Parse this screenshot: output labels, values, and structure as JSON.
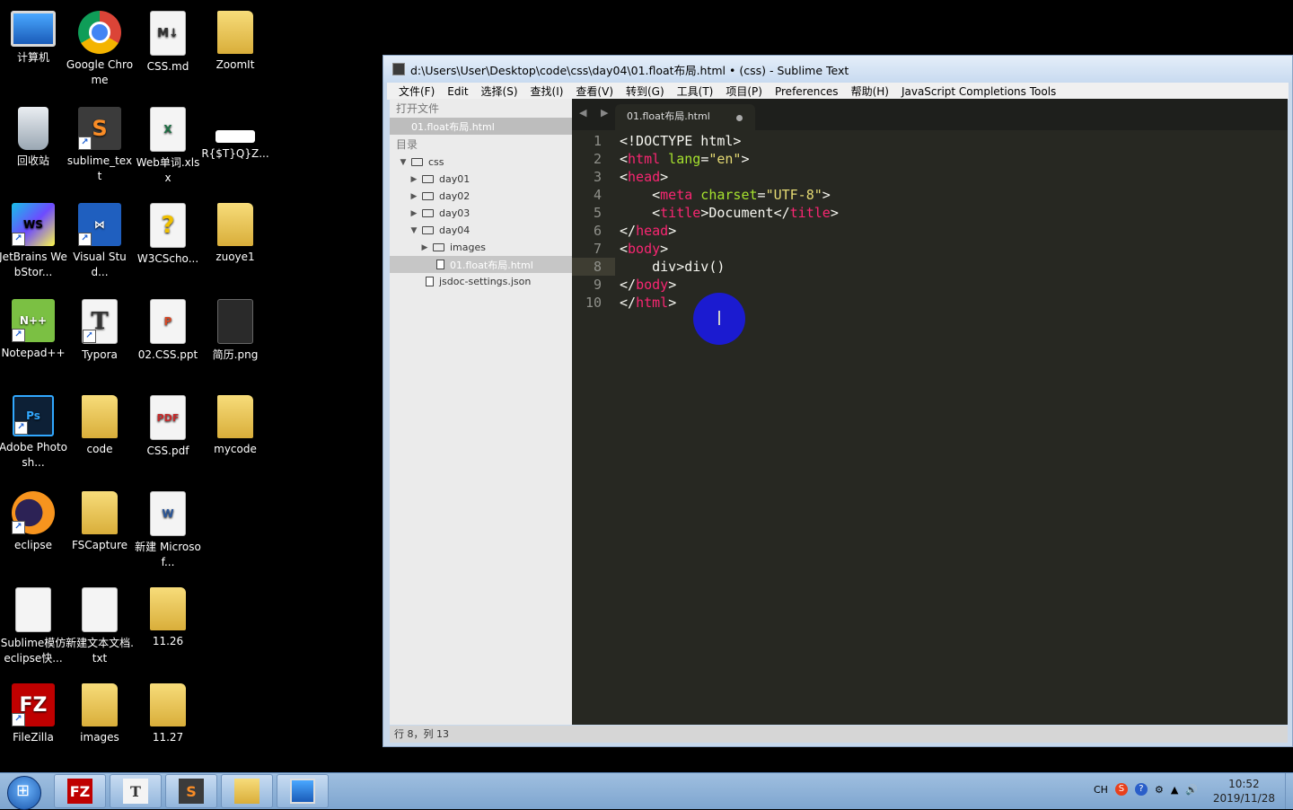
{
  "desktop": {
    "icons": [
      {
        "label": "计算机"
      },
      {
        "label": "Google Chrome"
      },
      {
        "label": "CSS.md"
      },
      {
        "label": "ZoomIt"
      },
      {
        "label": "回收站"
      },
      {
        "label": "sublime_text"
      },
      {
        "label": "Web单词.xlsx"
      },
      {
        "label": "R{$T}Q}Z..."
      },
      {
        "label": "JetBrains WebStor..."
      },
      {
        "label": "Visual Stud..."
      },
      {
        "label": "W3CScho..."
      },
      {
        "label": "zuoye1"
      },
      {
        "label": "Notepad++"
      },
      {
        "label": "Typora"
      },
      {
        "label": "02.CSS.ppt"
      },
      {
        "label": "简历.png"
      },
      {
        "label": "Adobe Photosh..."
      },
      {
        "label": "code"
      },
      {
        "label": "CSS.pdf"
      },
      {
        "label": "mycode"
      },
      {
        "label": "eclipse"
      },
      {
        "label": "FSCapture"
      },
      {
        "label": "新建 Microsof..."
      },
      {
        "label": "Sublime模仿eclipse快..."
      },
      {
        "label": "新建文本文档.txt"
      },
      {
        "label": "11.26"
      },
      {
        "label": "FileZilla"
      },
      {
        "label": "images"
      },
      {
        "label": "11.27"
      }
    ]
  },
  "window": {
    "title": "d:\\Users\\User\\Desktop\\code\\css\\day04\\01.float布局.html • (css) - Sublime Text",
    "menu": [
      "文件(F)",
      "Edit",
      "选择(S)",
      "查找(I)",
      "查看(V)",
      "转到(G)",
      "工具(T)",
      "项目(P)",
      "Preferences",
      "帮助(H)",
      "JavaScript Completions Tools"
    ]
  },
  "sidebar": {
    "open_files_header": "打开文件",
    "open_file": "01.float布局.html",
    "folders_header": "目录",
    "tree": {
      "css": "css",
      "day01": "day01",
      "day02": "day02",
      "day03": "day03",
      "day04": "day04",
      "images": "images",
      "file_active": "01.float布局.html",
      "jsdoc": "jsdoc-settings.json"
    }
  },
  "editor": {
    "tab_label": "01.float布局.html",
    "line_numbers": [
      "1",
      "2",
      "3",
      "4",
      "5",
      "6",
      "7",
      "8",
      "9",
      "10"
    ],
    "lines": {
      "l1": "<!DOCTYPE html>",
      "l2_open": "<",
      "l2_tag": "html",
      "l2_attr": " lang",
      "l2_eq": "=",
      "l2_val": "\"en\"",
      "l2_close": ">",
      "l3_open": "<",
      "l3_tag": "head",
      "l3_close": ">",
      "l4_indent": "    <",
      "l4_tag": "meta",
      "l4_attr": " charset",
      "l4_eq": "=",
      "l4_val": "\"UTF-8\"",
      "l4_close": ">",
      "l5_indent": "    <",
      "l5_tag": "title",
      "l5_mid": ">Document</",
      "l5_tag2": "title",
      "l5_close": ">",
      "l6_open": "</",
      "l6_tag": "head",
      "l6_close": ">",
      "l7_open": "<",
      "l7_tag": "body",
      "l7_close": ">",
      "l8": "    div>div()",
      "l9_open": "</",
      "l9_tag": "body",
      "l9_close": ">",
      "l10_open": "</",
      "l10_tag": "html",
      "l10_close": ">"
    }
  },
  "status": {
    "position": "行 8，列 13"
  },
  "taskbar": {
    "tray_lang": "CH",
    "time": "10:52",
    "date": "2019/11/28"
  }
}
